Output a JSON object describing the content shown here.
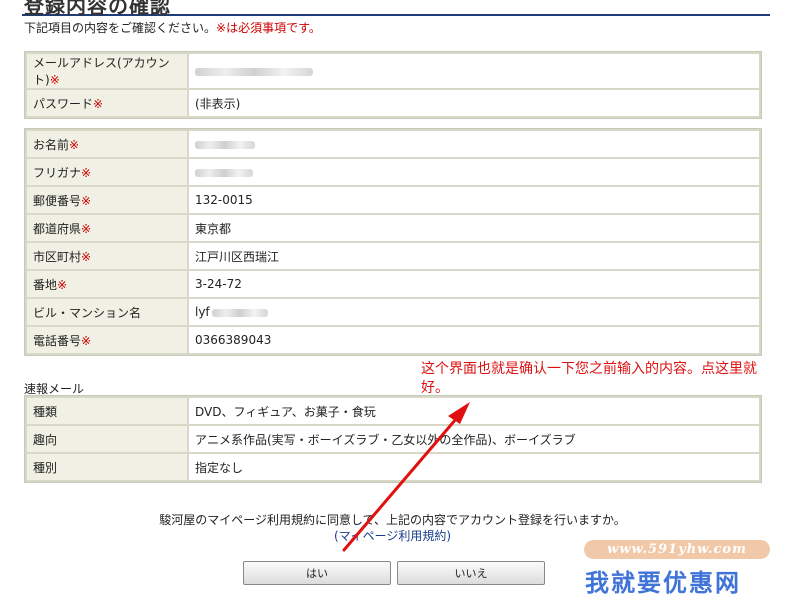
{
  "page": {
    "title": "登録内容の確認",
    "intro_text": "下記項目の内容をご確認ください。",
    "intro_required": "※は必須事項です。"
  },
  "required_mark": "※",
  "account": {
    "email": {
      "label": "メールアドレス(アカウント)",
      "value": ""
    },
    "password": {
      "label": "パスワード",
      "value": "(非表示)"
    }
  },
  "profile": {
    "name": {
      "label": "お名前",
      "value": ""
    },
    "kana": {
      "label": "フリガナ",
      "value": ""
    },
    "postal": {
      "label": "郵便番号",
      "value": "132-0015"
    },
    "prefecture": {
      "label": "都道府県",
      "value": "東京都"
    },
    "city": {
      "label": "市区町村",
      "value": "江戸川区西瑞江"
    },
    "address": {
      "label": "番地",
      "value": "3-24-72"
    },
    "building": {
      "label": "ビル・マンション名",
      "value": "lyf"
    },
    "phone": {
      "label": "電話番号",
      "value": "0366389043"
    }
  },
  "newsletter": {
    "section_label": "速報メール",
    "type": {
      "label": "種類",
      "value": "DVD、フィギュア、お菓子・食玩"
    },
    "preference": {
      "label": "趣向",
      "value": "アニメ系作品(実写・ボーイズラブ・乙女以外の全作品)、ボーイズラブ"
    },
    "category": {
      "label": "種別",
      "value": "指定なし"
    }
  },
  "confirm": {
    "text": "駿河屋のマイページ利用規約に同意して、上記の内容でアカウント登録を行いますか。",
    "terms_link": "(マイページ利用規約)",
    "yes_label": "はい",
    "no_label": "いいえ"
  },
  "annotation": {
    "text": "这个界面也就是确认一下您之前输入的内容。点这里就好。",
    "color": "#dd1111"
  },
  "watermark": {
    "url": "www.591yhw.com",
    "name": "我就要优惠网"
  }
}
